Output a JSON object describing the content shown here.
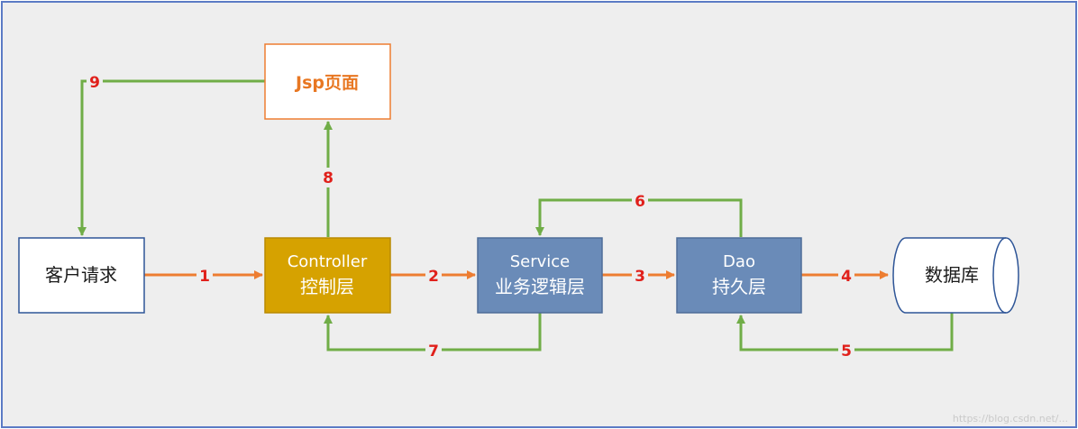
{
  "colors": {
    "frame_border": "#5b7bc5",
    "canvas_background": "#eeeeee",
    "arrow_request": "#ed7d31",
    "arrow_response": "#70ad47",
    "step_number": "#e0201b",
    "box_white_border": "#2e5597",
    "jsp_border": "#ed7d31",
    "jsp_text": "#e87722",
    "controller_fill": "#d6a200",
    "service_fill": "#6a8bb8",
    "dao_fill": "#6a8bb8",
    "database_border": "#2e5597"
  },
  "nodes": {
    "client": {
      "label": "客户请求"
    },
    "jsp": {
      "label": "Jsp页面"
    },
    "controller": {
      "line1": "Controller",
      "line2": "控制层"
    },
    "service": {
      "line1": "Service",
      "line2": "业务逻辑层"
    },
    "dao": {
      "line1": "Dao",
      "line2": "持久层"
    },
    "database": {
      "label": "数据库"
    }
  },
  "steps": {
    "s1": "1",
    "s2": "2",
    "s3": "3",
    "s4": "4",
    "s5": "5",
    "s6": "6",
    "s7": "7",
    "s8": "8",
    "s9": "9"
  },
  "watermark": "https://blog.csdn.net/..."
}
